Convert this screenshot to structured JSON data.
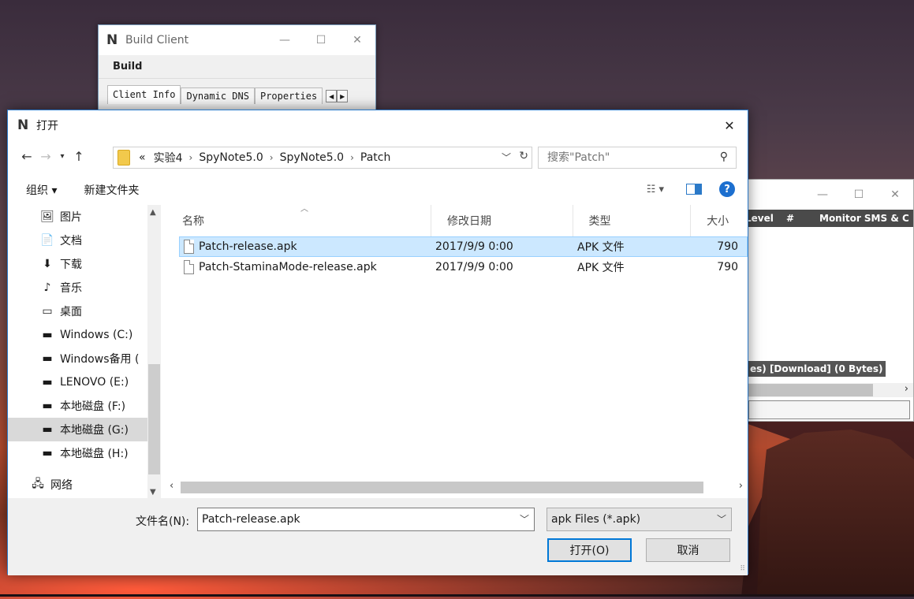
{
  "build_client": {
    "title": "Build Client",
    "menu": "Build",
    "tabs": [
      "Client Info",
      "Dynamic DNS",
      "Properties"
    ]
  },
  "right_window": {
    "grid_headers": [
      "Level",
      "#",
      "Monitor SMS & C"
    ],
    "status": "es) [Download] (0 Bytes)"
  },
  "dialog": {
    "title": "打开",
    "address": {
      "overflow": "«",
      "crumbs": [
        "实验4",
        "SpyNote5.0",
        "SpyNote5.0",
        "Patch"
      ]
    },
    "search_placeholder": "搜索\"Patch\"",
    "toolbar": {
      "organize": "组织 ▾",
      "new_folder": "新建文件夹"
    },
    "nav_items": [
      {
        "label": "图片",
        "icon": "🖼"
      },
      {
        "label": "文档",
        "icon": "📄"
      },
      {
        "label": "下载",
        "icon": "⬇"
      },
      {
        "label": "音乐",
        "icon": "♪"
      },
      {
        "label": "桌面",
        "icon": "▭"
      },
      {
        "label": "Windows (C:)",
        "icon": "▬"
      },
      {
        "label": "Windows备用 (",
        "icon": "▬"
      },
      {
        "label": "LENOVO (E:)",
        "icon": "▬"
      },
      {
        "label": "本地磁盘 (F:)",
        "icon": "▬"
      },
      {
        "label": "本地磁盘 (G:)",
        "icon": "▬"
      },
      {
        "label": "本地磁盘 (H:)",
        "icon": "▬"
      }
    ],
    "nav_network": "网络",
    "columns": {
      "name": "名称",
      "date": "修改日期",
      "type": "类型",
      "size": "大小"
    },
    "files": [
      {
        "name": "Patch-release.apk",
        "date": "2017/9/9 0:00",
        "type": "APK 文件",
        "size": "790"
      },
      {
        "name": "Patch-StaminaMode-release.apk",
        "date": "2017/9/9 0:00",
        "type": "APK 文件",
        "size": "790"
      }
    ],
    "filename_label": "文件名(N):",
    "filename_value": "Patch-release.apk",
    "filter_value": "apk Files (*.apk)",
    "open_button": "打开(O)",
    "cancel_button": "取消"
  },
  "colors": {
    "accent": "#0078d7",
    "selection": "#cce8ff"
  }
}
